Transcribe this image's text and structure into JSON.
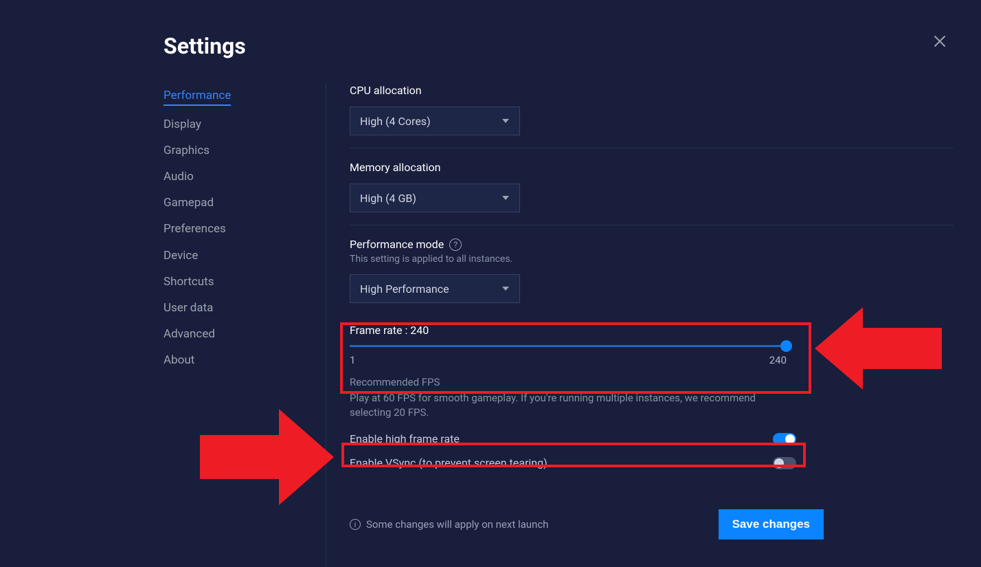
{
  "title": "Settings",
  "sidebar": {
    "items": [
      {
        "label": "Performance",
        "active": true
      },
      {
        "label": "Display"
      },
      {
        "label": "Graphics"
      },
      {
        "label": "Audio"
      },
      {
        "label": "Gamepad"
      },
      {
        "label": "Preferences"
      },
      {
        "label": "Device"
      },
      {
        "label": "Shortcuts"
      },
      {
        "label": "User data"
      },
      {
        "label": "Advanced"
      },
      {
        "label": "About"
      }
    ]
  },
  "cpu": {
    "label": "CPU allocation",
    "value": "High (4 Cores)"
  },
  "memory": {
    "label": "Memory allocation",
    "value": "High (4 GB)"
  },
  "perfmode": {
    "label": "Performance mode",
    "sub": "This setting is applied to all instances.",
    "value": "High Performance"
  },
  "framerate": {
    "label_prefix": "Frame rate : ",
    "value": "240",
    "min": "1",
    "max": "240"
  },
  "recommended": {
    "title": "Recommended FPS",
    "text": "Play at 60 FPS for smooth gameplay. If you're running multiple instances, we recommend selecting 20 FPS."
  },
  "toggles": {
    "hfr": {
      "label": "Enable high frame rate",
      "on": true
    },
    "vsync": {
      "label": "Enable VSync (to prevent screen tearing)",
      "on": false
    }
  },
  "footer": {
    "note": "Some changes will apply on next launch",
    "save": "Save changes"
  }
}
